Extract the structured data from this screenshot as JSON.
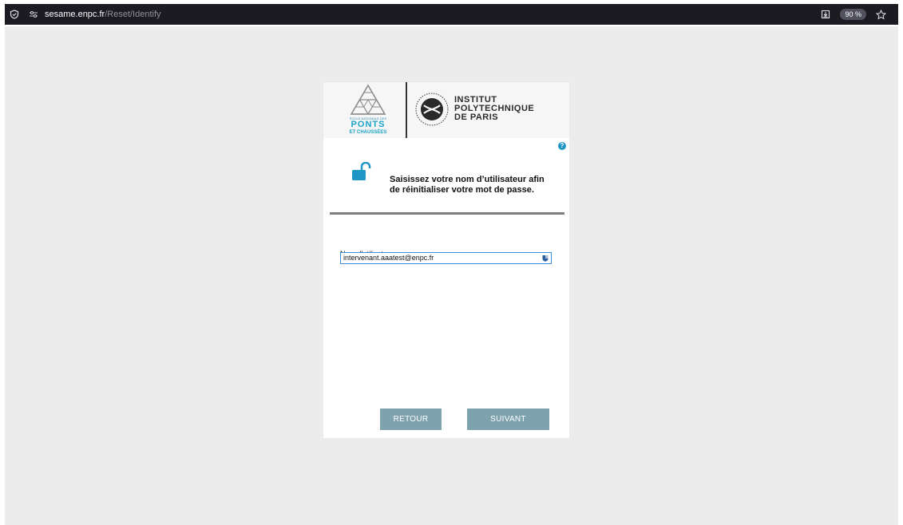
{
  "browser": {
    "url_host": "sesame.enpc.fr",
    "url_path": "/Reset/Identify",
    "zoom": "90 %"
  },
  "header": {
    "ponts_small": "ÉCOLE NATIONALE DES",
    "ponts_big": "PONTS",
    "ponts_sub": "ET CHAUSSÉES",
    "ipp_line1": "INSTITUT",
    "ipp_line2": "POLYTECHNIQUE",
    "ipp_line3": "DE PARIS"
  },
  "form": {
    "help_glyph": "?",
    "instruction_line1": "Saisissez votre nom d’utilisateur afin",
    "instruction_line2": "de réinitialiser votre mot de passe.",
    "username_label": "Nom d'utilisateur:",
    "username_value": "intervenant.aaatest@enpc.fr",
    "back_label": "RETOUR",
    "next_label": "SUIVANT"
  },
  "colors": {
    "accent": "#1f96c6",
    "button": "#7ea3ae"
  }
}
